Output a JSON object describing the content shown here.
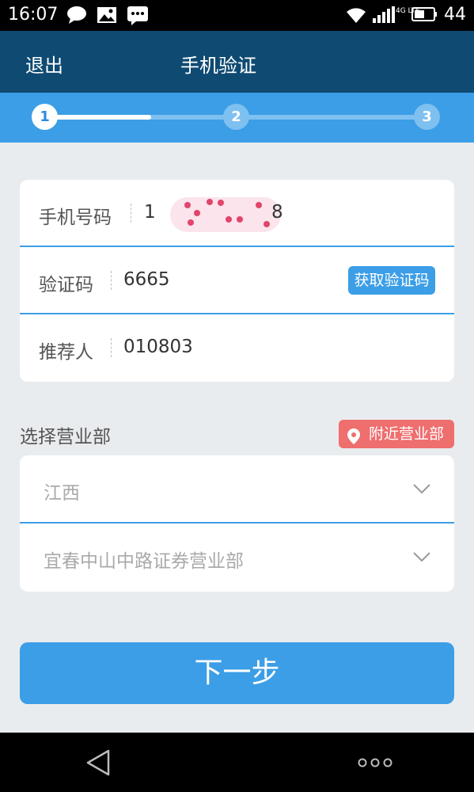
{
  "status_bar": {
    "time": "16:07",
    "network": "4G LTE",
    "battery": "44",
    "icons": [
      "chat-icon",
      "image-icon",
      "message-icon",
      "wifi-icon",
      "signal-icon",
      "battery-icon"
    ]
  },
  "header": {
    "back_label": "退出",
    "title": "手机验证"
  },
  "stepper": {
    "steps": [
      "1",
      "2",
      "3"
    ],
    "current": 1,
    "progress_fraction": 0.275
  },
  "form": {
    "phone_label": "手机号码",
    "phone_value_start": "1",
    "phone_value_end": "8",
    "code_label": "验证码",
    "code_value": "6665",
    "get_code_label": "获取验证码",
    "referrer_label": "推荐人",
    "referrer_value": "010803"
  },
  "branch": {
    "section_title": "选择营业部",
    "nearby_label": "附近营业部",
    "province": "江西",
    "branch_name": "宜春中山中路证券营业部"
  },
  "next_button": "下一步",
  "colors": {
    "header_bg": "#0f4a72",
    "accent": "#3c9ee6",
    "nearby": "#ef6e6e",
    "page_bg": "#e9ecef"
  }
}
